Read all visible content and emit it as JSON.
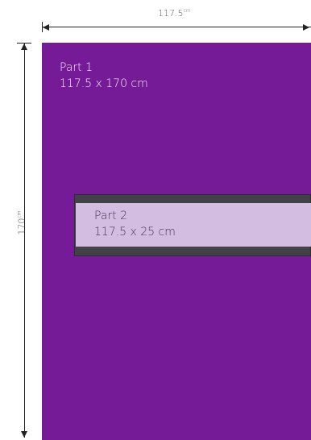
{
  "dimensions": {
    "width_value": "117.5",
    "height_value": "170",
    "unit": "cm"
  },
  "parts": [
    {
      "name": "Part 1",
      "size": "117.5 x 170 cm",
      "color": "#751b98"
    },
    {
      "name": "Part 2",
      "size": "117.5 x 25 cm",
      "color": "#d3bde0"
    }
  ]
}
